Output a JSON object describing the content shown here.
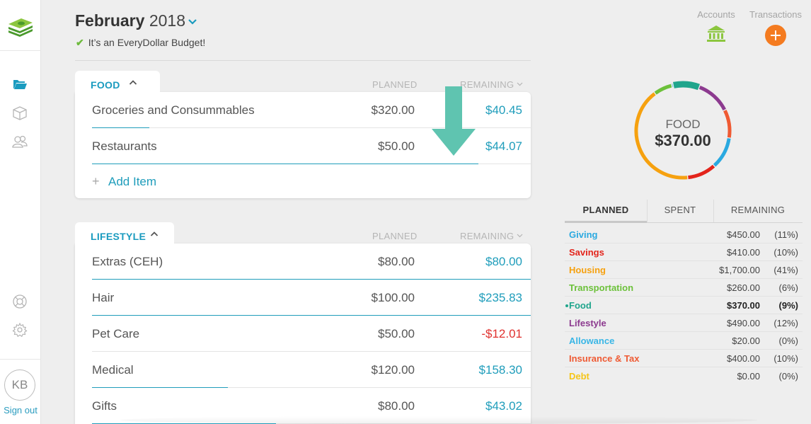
{
  "header": {
    "month": "February",
    "year": "2018",
    "subtitle": "It’s an EveryDollar Budget!"
  },
  "sidebar": {
    "avatar_initials": "KB",
    "signout_label": "Sign out"
  },
  "topbar": {
    "accounts_label": "Accounts",
    "transactions_label": "Transactions"
  },
  "food": {
    "name": "FOOD",
    "planned_label": "PLANNED",
    "remaining_label": "REMAINING",
    "items": [
      {
        "name": "Groceries and Consummables",
        "planned": "$320.00",
        "remaining": "$40.45",
        "spent_fraction": 0.13
      },
      {
        "name": "Restaurants",
        "planned": "$50.00",
        "remaining": "$44.07",
        "spent_fraction": 0.88
      }
    ],
    "add_item_label": "Add Item"
  },
  "lifestyle": {
    "name": "LIFESTYLE",
    "planned_label": "PLANNED",
    "remaining_label": "REMAINING",
    "items": [
      {
        "name": "Extras (CEH)",
        "planned": "$80.00",
        "remaining": "$80.00",
        "spent_fraction": 1.0
      },
      {
        "name": "Hair",
        "planned": "$100.00",
        "remaining": "$235.83",
        "spent_fraction": 1.0
      },
      {
        "name": "Pet Care",
        "planned": "$50.00",
        "remaining": "-$12.01",
        "spent_fraction": 0
      },
      {
        "name": "Medical",
        "planned": "$120.00",
        "remaining": "$158.30",
        "spent_fraction": 0.31
      },
      {
        "name": "Gifts",
        "planned": "$80.00",
        "remaining": "$43.02",
        "spent_fraction": 0.42
      }
    ]
  },
  "summary": {
    "donut_label": "FOOD",
    "donut_value": "$370.00",
    "tabs": [
      "PLANNED",
      "SPENT",
      "REMAINING"
    ],
    "rows": [
      {
        "name": "Giving",
        "amount": "$450.00",
        "pct": "(11%)",
        "color": "#2aa9e0"
      },
      {
        "name": "Savings",
        "amount": "$410.00",
        "pct": "(10%)",
        "color": "#e3241b"
      },
      {
        "name": "Housing",
        "amount": "$1,700.00",
        "pct": "(41%)",
        "color": "#f6a10f"
      },
      {
        "name": "Transportation",
        "amount": "$260.00",
        "pct": "(6%)",
        "color": "#6cc13a"
      },
      {
        "name": "Food",
        "amount": "$370.00",
        "pct": "(9%)",
        "color": "#1fa58c"
      },
      {
        "name": "Lifestyle",
        "amount": "$490.00",
        "pct": "(12%)",
        "color": "#8c3a8f"
      },
      {
        "name": "Allowance",
        "amount": "$20.00",
        "pct": "(0%)",
        "color": "#39b6e6"
      },
      {
        "name": "Insurance & Tax",
        "amount": "$400.00",
        "pct": "(10%)",
        "color": "#ef5a33"
      },
      {
        "name": "Debt",
        "amount": "$0.00",
        "pct": "(0%)",
        "color": "#f5c518"
      }
    ]
  }
}
